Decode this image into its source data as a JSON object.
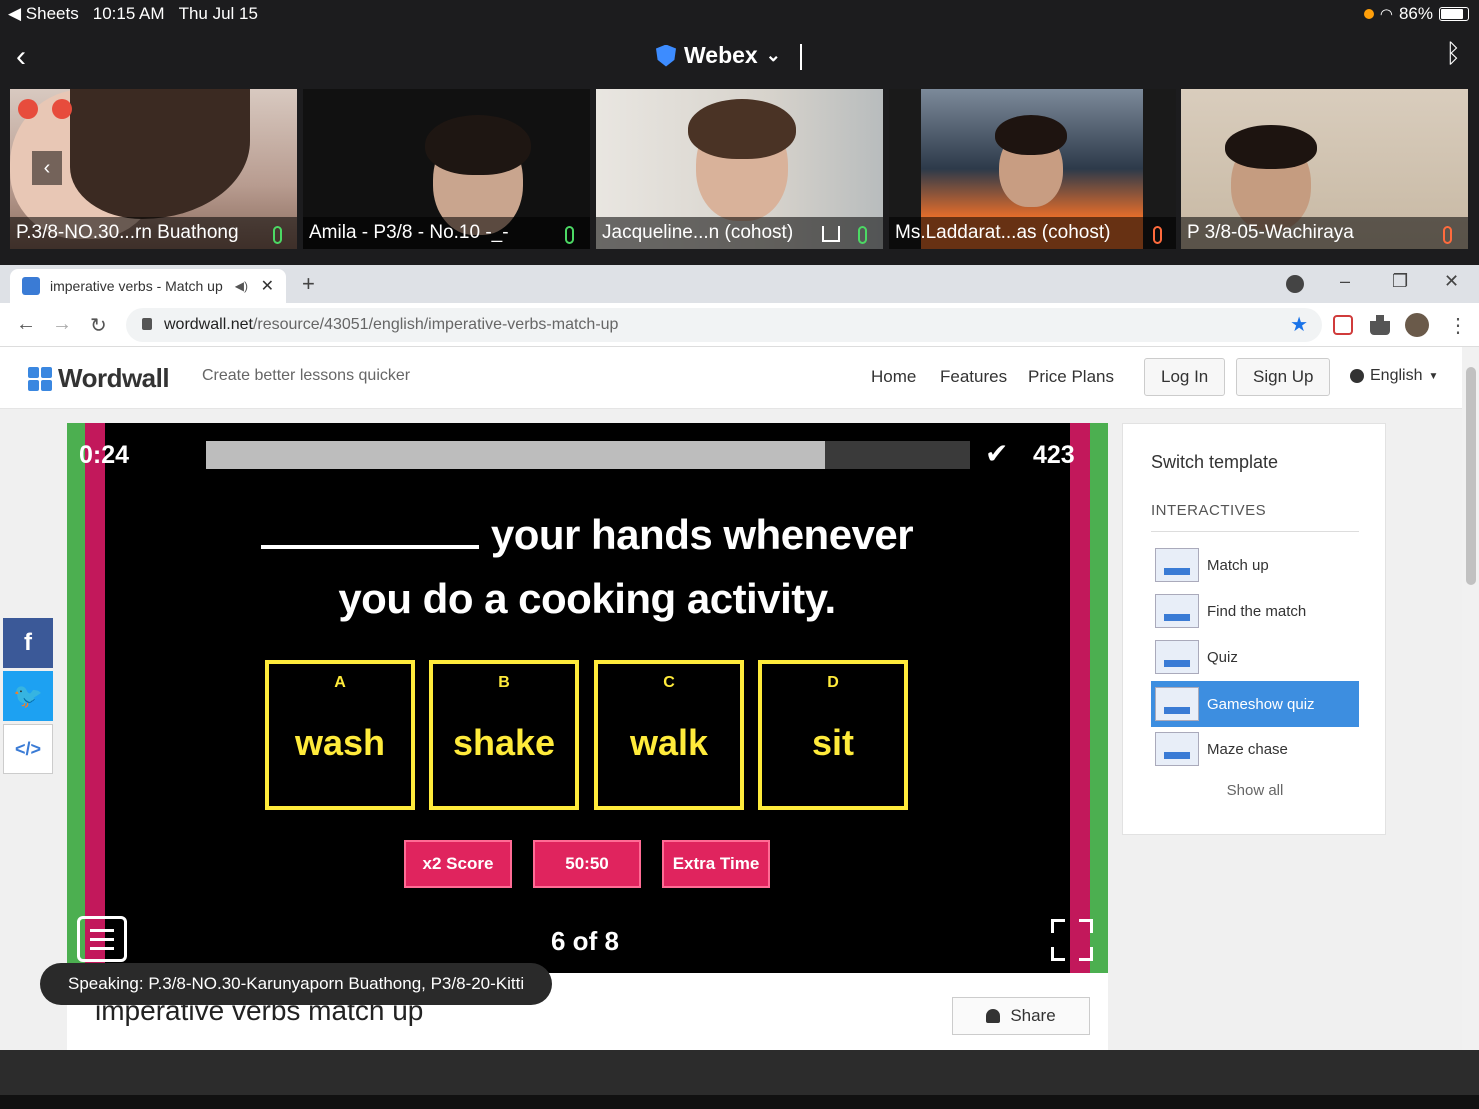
{
  "status_bar": {
    "back_app": "Sheets",
    "time": "10:15 AM",
    "date": "Thu Jul 15",
    "battery": "86%"
  },
  "webex": {
    "title": "Webex"
  },
  "participants": [
    {
      "name": "P.3/8-NO.30...rn Buathong",
      "mic": "on"
    },
    {
      "name": "Amila - P3/8 - No.10 -_-",
      "mic": "on"
    },
    {
      "name": "Jacqueline...n (cohost)",
      "mic": "on"
    },
    {
      "name": "Ms.Laddarat...as (cohost)",
      "mic": "muted"
    },
    {
      "name": "P 3/8-05-Wachiraya",
      "mic": "muted"
    }
  ],
  "browser": {
    "tab_title": "imperative verbs - Match up",
    "url_host": "wordwall.net",
    "url_path": "/resource/43051/english/imperative-verbs-match-up"
  },
  "wordwall": {
    "logo": "Wordwall",
    "tagline": "Create better lessons quicker",
    "nav": [
      "Home",
      "Features",
      "Price Plans"
    ],
    "login": "Log In",
    "signup": "Sign Up",
    "language": "English"
  },
  "game": {
    "timer": "0:24",
    "progress": 0.81,
    "score": "423",
    "question_line1": "your hands whenever",
    "question_line2": "you do a cooking activity.",
    "answers": [
      {
        "letter": "A",
        "word": "wash"
      },
      {
        "letter": "B",
        "word": "shake"
      },
      {
        "letter": "C",
        "word": "walk"
      },
      {
        "letter": "D",
        "word": "sit"
      }
    ],
    "powerups": [
      "x2 Score",
      "50:50",
      "Extra Time"
    ],
    "counter": "6 of 8"
  },
  "templates": {
    "title": "Switch template",
    "section": "INTERACTIVES",
    "items": [
      "Match up",
      "Find the match",
      "Quiz",
      "Gameshow quiz",
      "Maze chase"
    ],
    "active": "Gameshow quiz",
    "show_all": "Show all"
  },
  "activity": {
    "title": "imperative verbs match up",
    "share": "Share"
  },
  "speaking": "Speaking: P.3/8-NO.30-Karunyaporn Buathong, P3/8-20-Kitti"
}
